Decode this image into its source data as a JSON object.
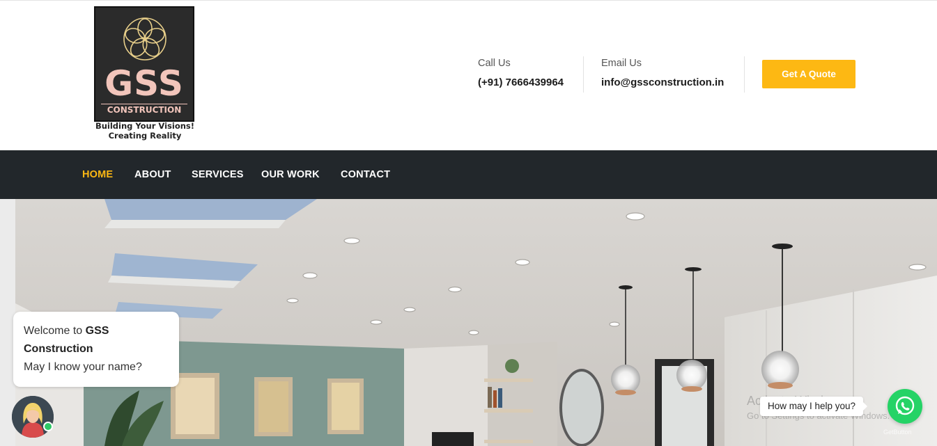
{
  "header": {
    "logo": {
      "brand": "GSS",
      "sub": "CONSTRUCTION",
      "tagline_1": "Building Your Visions!",
      "tagline_2": "Creating Reality"
    },
    "call": {
      "label": "Call Us",
      "value": "(+91) 7666439964"
    },
    "email": {
      "label": "Email Us",
      "value": "info@gssconstruction.in"
    },
    "quote_button": "Get A Quote"
  },
  "nav": {
    "items": [
      {
        "label": "HOME",
        "active": true
      },
      {
        "label": "ABOUT",
        "active": false
      },
      {
        "label": "SERVICES",
        "active": false
      },
      {
        "label": "OUR WORK",
        "active": false
      },
      {
        "label": "CONTACT",
        "active": false
      }
    ]
  },
  "chat": {
    "greeting_prefix": "Welcome to ",
    "greeting_brand": "GSS Construction",
    "question": "May I know your name?"
  },
  "whatsapp": {
    "tooltip": "How may I help you?",
    "credit": "GetButton"
  },
  "watermark": {
    "line1": "Activate Windows",
    "line2": "Go to Settings to activate Windows."
  },
  "colors": {
    "accent": "#fdb813",
    "nav_bg": "#22272b",
    "whatsapp": "#25d366"
  }
}
